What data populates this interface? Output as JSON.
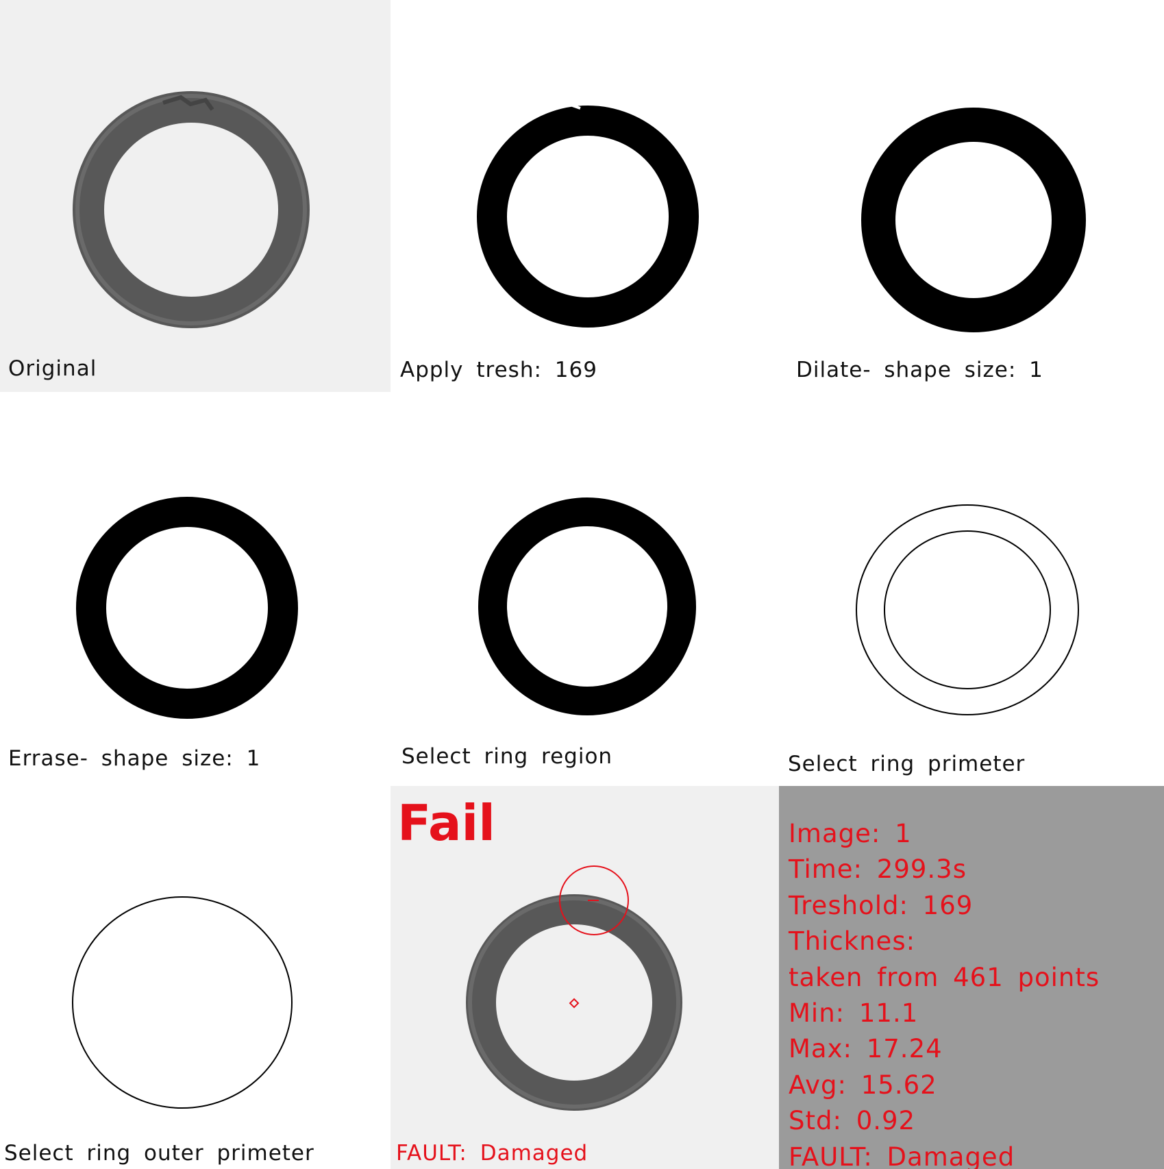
{
  "panels": {
    "original": {
      "caption": "Original"
    },
    "threshold": {
      "caption": "Apply tresh: 169"
    },
    "dilate": {
      "caption": "Dilate- shape size: 1"
    },
    "erase": {
      "caption": "Errase- shape size: 1"
    },
    "region": {
      "caption": "Select ring region"
    },
    "perimeter": {
      "caption": "Select ring primeter"
    },
    "outer": {
      "caption": "Select ring outer primeter"
    },
    "result": {
      "verdict": "Fail",
      "caption": "FAULT: Damaged"
    }
  },
  "stats": {
    "lines": [
      "Image: 1",
      "Time: 299.3s",
      "Treshold: 169",
      "Thicknes:",
      "taken from 461 points",
      "Min: 11.1",
      "Max: 17.24",
      "Avg: 15.62",
      "Std: 0.92",
      "FAULT: Damaged"
    ]
  },
  "colors": {
    "fault": "#e5111b",
    "stats_background": "#9b9b9b",
    "original_background": "#f0f0f0",
    "ring_gray": "#5a5a5a"
  }
}
